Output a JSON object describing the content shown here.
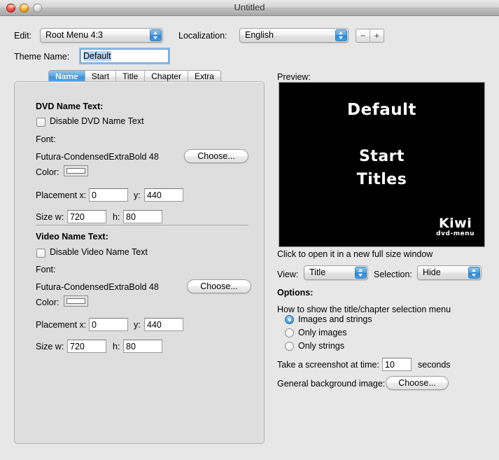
{
  "window": {
    "title": "Untitled",
    "traffic_lights": [
      "close-button",
      "minimize-button",
      "zoom-button"
    ]
  },
  "toolbar": {
    "edit_label": "Edit:",
    "edit_value": "Root Menu 4:3",
    "localization_label": "Localization:",
    "localization_value": "English",
    "remove_label": "−",
    "add_label": "+"
  },
  "theme": {
    "name_label": "Theme Name:",
    "name_value": "Default"
  },
  "tabs": [
    {
      "label": "Name",
      "active": true
    },
    {
      "label": "Start",
      "active": false
    },
    {
      "label": "Title",
      "active": false
    },
    {
      "label": "Chapter",
      "active": false
    },
    {
      "label": "Extra",
      "active": false
    }
  ],
  "dvd_name_text": {
    "heading": "DVD Name Text:",
    "disable_label": "Disable DVD Name Text",
    "disable_checked": false,
    "font_label": "Font:",
    "font_value": "Futura-CondensedExtraBold 48",
    "choose_label": "Choose...",
    "color_label": "Color:",
    "color_value": "#ffffff",
    "placement_label": "Placement x:",
    "placement_x": "0",
    "placement_y_label": "y:",
    "placement_y": "440",
    "size_label": "Size w:",
    "size_w": "720",
    "size_h_label": "h:",
    "size_h": "80"
  },
  "video_name_text": {
    "heading": "Video Name Text:",
    "disable_label": "Disable Video Name Text",
    "disable_checked": false,
    "font_label": "Font:",
    "font_value": "Futura-CondensedExtraBold 48",
    "choose_label": "Choose...",
    "color_label": "Color:",
    "color_value": "#ffffff",
    "placement_label": "Placement x:",
    "placement_x": "0",
    "placement_y_label": "y:",
    "placement_y": "440",
    "size_label": "Size w:",
    "size_w": "720",
    "size_h_label": "h:",
    "size_h": "80"
  },
  "preview": {
    "heading": "Preview:",
    "menu_title": "Default",
    "menu_start": "Start",
    "menu_titles": "Titles",
    "logo_main": "Kiwi",
    "logo_sub": "dvd-menu",
    "hint": "Click to open it in a new full size window",
    "view_label": "View:",
    "view_value": "Title",
    "selection_label": "Selection:",
    "selection_value": "Hide",
    "background_color": "#000000",
    "text_color": "#ffffff"
  },
  "options": {
    "heading": "Options:",
    "menu_mode_label": "How to show the title/chapter selection menu",
    "radios": [
      {
        "label": "Images and strings",
        "selected": true
      },
      {
        "label": "Only images",
        "selected": false
      },
      {
        "label": "Only strings",
        "selected": false
      }
    ],
    "screenshot_label": "Take a screenshot at time:",
    "screenshot_value": "10",
    "screenshot_unit": "seconds",
    "background_image_label": "General background image:",
    "background_image_choose": "Choose..."
  }
}
